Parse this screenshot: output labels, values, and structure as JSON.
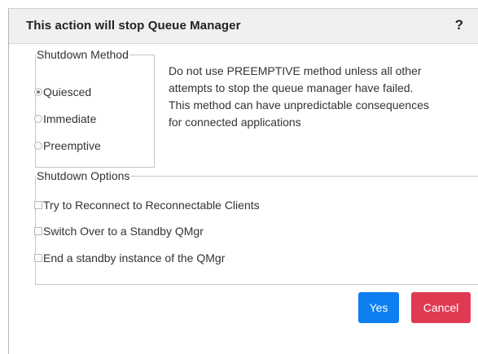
{
  "dialog": {
    "title": "This action will stop Queue Manager",
    "help_label": "?",
    "shutdown_method": {
      "legend": "Shutdown Method",
      "options": [
        {
          "label": "Quiesced",
          "selected": true
        },
        {
          "label": "Immediate",
          "selected": false
        },
        {
          "label": "Preemptive",
          "selected": false
        }
      ],
      "note_lines": [
        "Do not use PREEMPTIVE method unless all other",
        "attempts to stop the queue manager have failed.",
        "This method can have unpredictable consequences",
        "for connected applications"
      ]
    },
    "shutdown_options": {
      "legend": "Shutdown Options",
      "items": [
        {
          "label": "Try to Reconnect to Reconnectable Clients",
          "checked": false
        },
        {
          "label": "Switch Over to a Standby QMgr",
          "checked": false
        },
        {
          "label": "End a standby instance of the QMgr",
          "checked": false
        }
      ]
    },
    "buttons": {
      "yes_label": "Yes",
      "cancel_label": "Cancel"
    },
    "colors": {
      "header_bg": "#f0f0f0",
      "yes_button": "#0d7ff0",
      "cancel_button": "#e03a52"
    }
  }
}
